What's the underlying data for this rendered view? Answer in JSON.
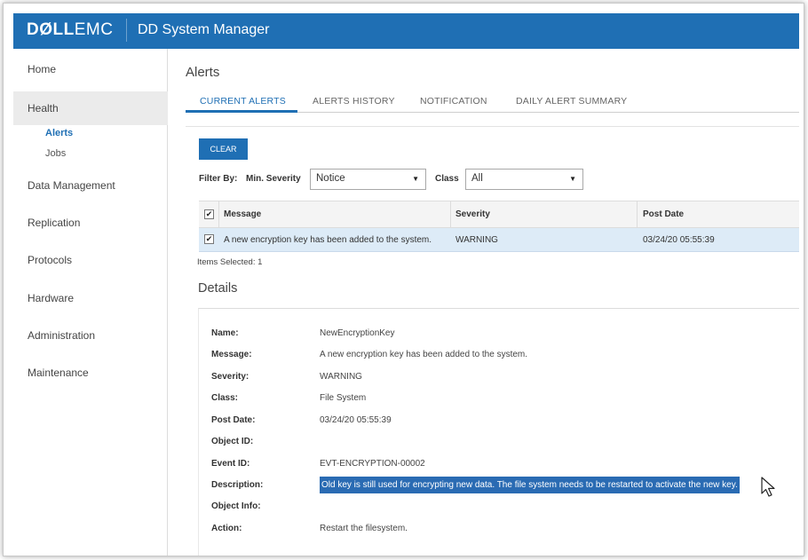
{
  "header": {
    "brand_part1": "DØLL",
    "brand_part2": "EMC",
    "app_title": "DD System Manager",
    "brand_color": "#1f6fb4"
  },
  "sidebar": {
    "items": [
      {
        "label": "Home"
      },
      {
        "label": "Health"
      },
      {
        "label": "Data Management"
      },
      {
        "label": "Replication"
      },
      {
        "label": "Protocols"
      },
      {
        "label": "Hardware"
      },
      {
        "label": "Administration"
      },
      {
        "label": "Maintenance"
      }
    ],
    "health_sub": [
      {
        "label": "Alerts"
      },
      {
        "label": "Jobs"
      }
    ]
  },
  "main": {
    "title": "Alerts",
    "tabs": [
      {
        "label": "CURRENT ALERTS"
      },
      {
        "label": "ALERTS HISTORY"
      },
      {
        "label": "NOTIFICATION"
      },
      {
        "label": "DAILY ALERT SUMMARY"
      }
    ],
    "clear_label": "CLEAR",
    "filter": {
      "filter_by": "Filter By:",
      "min_severity_label": "Min. Severity",
      "min_severity_value": "Notice",
      "class_label": "Class",
      "class_value": "All"
    },
    "table": {
      "columns": [
        "Message",
        "Severity",
        "Post Date"
      ],
      "rows": [
        {
          "message": "A new encryption key has been added to the system.",
          "severity": "WARNING",
          "post_date": "03/24/20 05:55:39"
        }
      ]
    },
    "items_selected": "Items Selected: 1",
    "details_title": "Details",
    "details": [
      {
        "key": "Name:",
        "value": "NewEncryptionKey"
      },
      {
        "key": "Message:",
        "value": "A new encryption key has been added to the system."
      },
      {
        "key": "Severity:",
        "value": "WARNING"
      },
      {
        "key": "Class:",
        "value": "File System"
      },
      {
        "key": "Post Date:",
        "value": "03/24/20 05:55:39"
      },
      {
        "key": "Object ID:",
        "value": ""
      },
      {
        "key": "Event ID:",
        "value": "EVT-ENCRYPTION-00002"
      },
      {
        "key": "Description:",
        "value": "Old key is still used for encrypting new data. The file system needs to be restarted to activate the new key."
      },
      {
        "key": "Object Info:",
        "value": ""
      },
      {
        "key": "Action:",
        "value": "Restart the filesystem."
      }
    ]
  },
  "icons": {
    "checkbox_checked": "check-icon",
    "dropdown": "chevron-down-icon",
    "cursor": "mouse-pointer-icon"
  }
}
